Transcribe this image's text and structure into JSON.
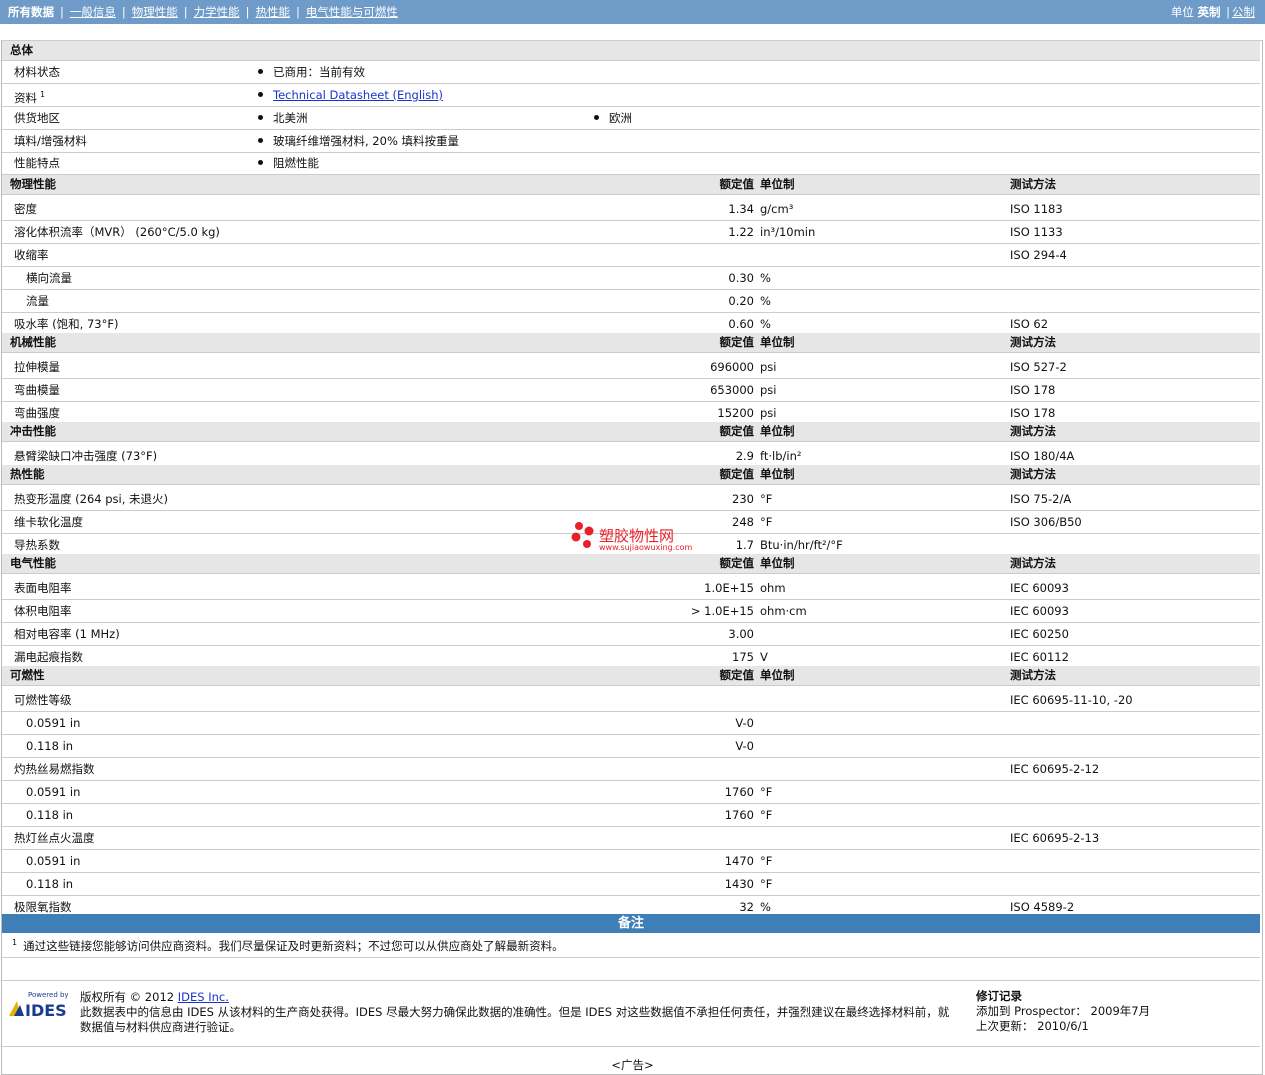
{
  "nav": {
    "items": [
      "所有数据",
      "一般信息",
      "物理性能",
      "力学性能",
      "热性能",
      "电气性能与可燃性"
    ],
    "units_label": "单位",
    "unit_imperial": "英制",
    "unit_metric": "公制"
  },
  "columns": {
    "nominal": "额定值",
    "unit": "单位制",
    "method": "测试方法"
  },
  "general": {
    "title": "总体",
    "status_label": "材料状态",
    "status_value": "已商用：当前有效",
    "resource_label": "资料",
    "resource_sup": "1",
    "resource_link": "Technical Datasheet (English)",
    "region_label": "供货地区",
    "region_1": "北美洲",
    "region_2": "欧洲",
    "filler_label": "填料/增强材料",
    "filler_value": "玻璃纤维增强材料, 20% 填料按重量",
    "feature_label": "性能特点",
    "feature_value": "阻燃性能"
  },
  "physical": {
    "title": "物理性能",
    "rows": [
      {
        "label": "密度",
        "value": "1.34",
        "unit": "g/cm³",
        "method": "ISO 1183"
      },
      {
        "label": "溶化体积流率（MVR） (260°C/5.0 kg)",
        "value": "1.22",
        "unit": "in³/10min",
        "method": "ISO 1133"
      },
      {
        "label": "收缩率",
        "value": "",
        "unit": "",
        "method": "ISO 294-4"
      },
      {
        "label": "横向流量",
        "value": "0.30",
        "unit": "%",
        "method": ""
      },
      {
        "label": "流量",
        "value": "0.20",
        "unit": "%",
        "method": ""
      },
      {
        "label": "吸水率 (饱和, 73°F)",
        "value": "0.60",
        "unit": "%",
        "method": "ISO 62"
      }
    ]
  },
  "mechanical": {
    "title": "机械性能",
    "rows": [
      {
        "label": "拉伸模量",
        "value": "696000",
        "unit": "psi",
        "method": "ISO 527-2"
      },
      {
        "label": "弯曲模量",
        "value": "653000",
        "unit": "psi",
        "method": "ISO 178"
      },
      {
        "label": "弯曲强度",
        "value": "15200",
        "unit": "psi",
        "method": "ISO 178"
      }
    ]
  },
  "impact": {
    "title": "冲击性能",
    "rows": [
      {
        "label": "悬臂梁缺口冲击强度 (73°F)",
        "value": "2.9",
        "unit": "ft·lb/in²",
        "method": "ISO 180/4A"
      }
    ]
  },
  "thermal": {
    "title": "热性能",
    "rows": [
      {
        "label": "热变形温度 (264 psi, 未退火)",
        "value": "230",
        "unit": "°F",
        "method": "ISO 75-2/A"
      },
      {
        "label": "维卡软化温度",
        "value": "248",
        "unit": "°F",
        "method": "ISO 306/B50"
      },
      {
        "label": "导热系数",
        "value": "1.7",
        "unit": "Btu·in/hr/ft²/°F",
        "method": ""
      }
    ]
  },
  "electrical": {
    "title": "电气性能",
    "rows": [
      {
        "label": "表面电阻率",
        "value": "1.0E+15",
        "unit": "ohm",
        "method": "IEC 60093"
      },
      {
        "label": "体积电阻率",
        "value": "> 1.0E+15",
        "unit": "ohm·cm",
        "method": "IEC 60093"
      },
      {
        "label": "相对电容率 (1 MHz)",
        "value": "3.00",
        "unit": "",
        "method": "IEC 60250"
      },
      {
        "label": "漏电起痕指数",
        "value": "175",
        "unit": "V",
        "method": "IEC 60112"
      }
    ]
  },
  "flammability": {
    "title": "可燃性",
    "rows": [
      {
        "label": "可燃性等级",
        "value": "",
        "unit": "",
        "method": "IEC 60695-11-10, -20"
      },
      {
        "label": "0.0591 in",
        "value": "V-0",
        "unit": "",
        "method": ""
      },
      {
        "label": "0.118 in",
        "value": "V-0",
        "unit": "",
        "method": ""
      },
      {
        "label": "灼热丝易燃指数",
        "value": "",
        "unit": "",
        "method": "IEC 60695-2-12"
      },
      {
        "label": "0.0591 in",
        "value": "1760",
        "unit": "°F",
        "method": ""
      },
      {
        "label": "0.118 in",
        "value": "1760",
        "unit": "°F",
        "method": ""
      },
      {
        "label": "热灯丝点火温度",
        "value": "",
        "unit": "",
        "method": "IEC 60695-2-13"
      },
      {
        "label": "0.0591 in",
        "value": "1470",
        "unit": "°F",
        "method": ""
      },
      {
        "label": "0.118 in",
        "value": "1430",
        "unit": "°F",
        "method": ""
      },
      {
        "label": "极限氧指数",
        "value": "32",
        "unit": "%",
        "method": "ISO 4589-2"
      }
    ]
  },
  "notes": {
    "title": "备注",
    "footnote_num": "1",
    "footnote": "通过这些链接您能够访问供应商资料。我们尽量保证及时更新资料；不过您可以从供应商处了解最新资料。"
  },
  "footer": {
    "logo_top": "Powered by",
    "logo_text": "IDES",
    "copyright_prefix": "版权所有 © 2012 ",
    "copyright_link": "IDES Inc.",
    "disclaimer": "此数据表中的信息由 IDES 从该材料的生产商处获得。IDES 尽最大努力确保此数据的准确性。但是 IDES 对这些数据值不承担任何责任，并强烈建议在最终选择材料前，就数据值与材料供应商进行验证。",
    "rev_title": "修订记录",
    "rev_added": "添加到 Prospector：  2009年7月",
    "rev_updated": "上次更新：   2010/6/1"
  },
  "watermark": {
    "cn": "塑胶物性网",
    "url": "www.sujiaowuxing.com"
  },
  "ad": "<广告>"
}
